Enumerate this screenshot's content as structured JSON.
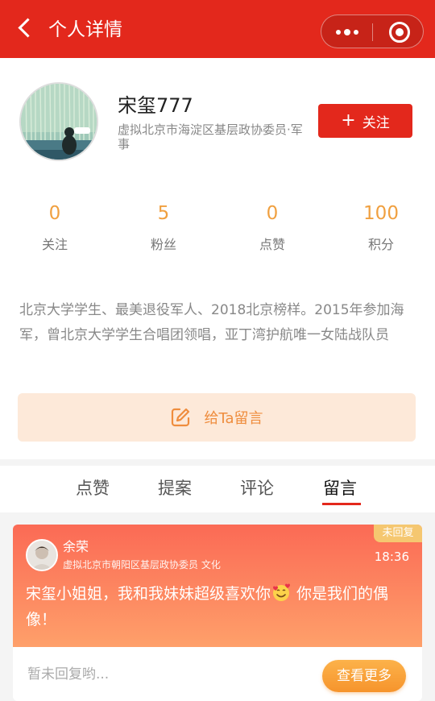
{
  "header": {
    "title": "个人详情",
    "bg_color": "#e3281c"
  },
  "profile": {
    "name": "宋玺777",
    "role": "虚拟北京市海淀区基层政协委员·军事",
    "follow_label": "关注",
    "stats": [
      {
        "value": "0",
        "label": "关注"
      },
      {
        "value": "5",
        "label": "粉丝"
      },
      {
        "value": "0",
        "label": "点赞"
      },
      {
        "value": "100",
        "label": "积分"
      }
    ],
    "bio": "北京大学学生、最美退役军人、2018北京榜样。2015年参加海军，曾北京大学学生合唱团领唱，亚丁湾护航唯一女陆战队员",
    "message_button": "给Ta留言"
  },
  "tabs": [
    {
      "label": "点赞"
    },
    {
      "label": "提案"
    },
    {
      "label": "评论"
    },
    {
      "label": "留言",
      "active": true
    }
  ],
  "message_card": {
    "badge": "未回复",
    "sender": "余荣",
    "sender_role": "虚拟北京市朝阳区基层政协委员 文化",
    "time": "18:36",
    "content_before": "宋玺小姐姐，我和我妹妹超级喜欢你",
    "content_after": " 你是我们的偶像！",
    "no_reply_text": "暂未回复哟...",
    "more_label": "查看更多"
  }
}
